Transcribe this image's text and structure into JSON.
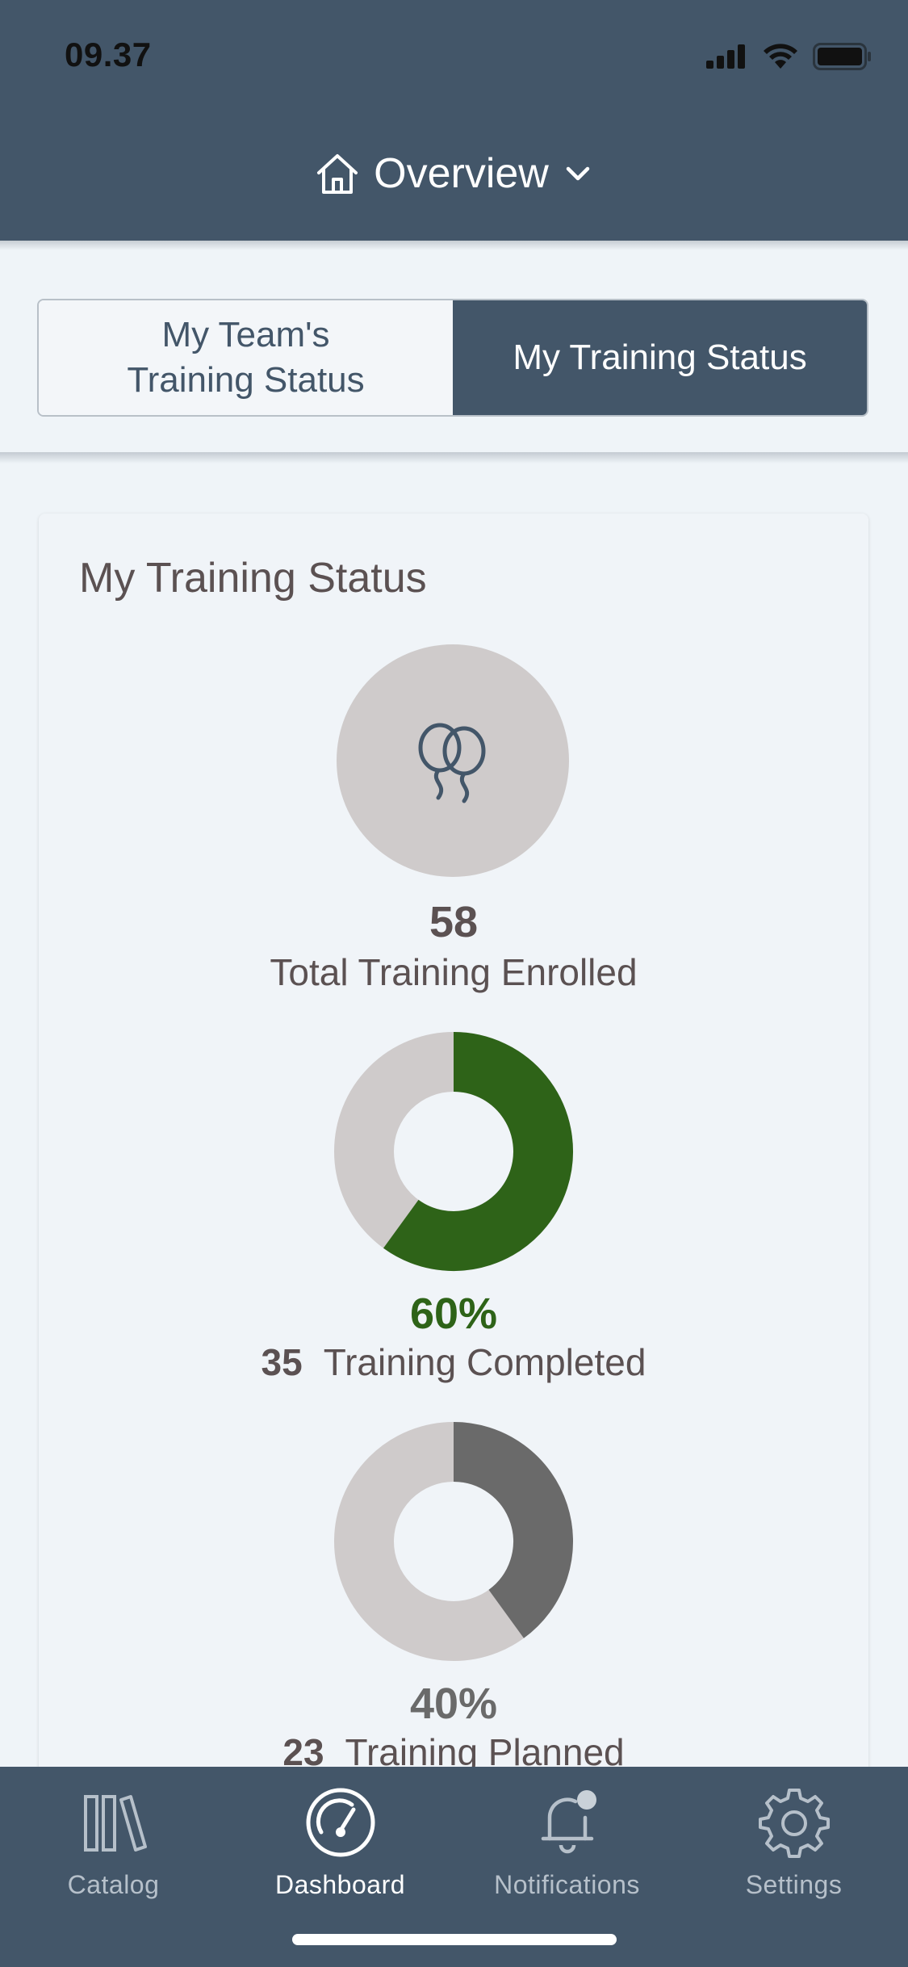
{
  "status_bar": {
    "time": "09.37"
  },
  "header": {
    "title": "Overview",
    "home_icon": "home-icon",
    "chevron_icon": "chevron-down-icon"
  },
  "segments": [
    {
      "label_line1": "My Team's",
      "label_line2": "Training Status",
      "active": false
    },
    {
      "label": "My Training Status",
      "active": true
    }
  ],
  "card": {
    "title": "My Training Status",
    "enrolled": {
      "count": "58",
      "label": "Total Training Enrolled",
      "icon": "balloons-icon"
    },
    "completed": {
      "percent": "60%",
      "count": "35",
      "label": "Training Completed",
      "fraction": 0.6,
      "color": "#2e6318"
    },
    "planned": {
      "percent": "40%",
      "count": "23",
      "label": "Training Planned",
      "fraction": 0.4,
      "color": "#6a6a6a"
    }
  },
  "colors": {
    "header": "#435669",
    "ring_track": "#cfcbcb",
    "background": "#eff4f8"
  },
  "tabbar": {
    "items": [
      {
        "label": "Catalog",
        "icon": "books-icon",
        "active": false
      },
      {
        "label": "Dashboard",
        "icon": "gauge-icon",
        "active": true
      },
      {
        "label": "Notifications",
        "icon": "bell-icon",
        "active": false
      },
      {
        "label": "Settings",
        "icon": "gear-icon",
        "active": false
      }
    ]
  }
}
